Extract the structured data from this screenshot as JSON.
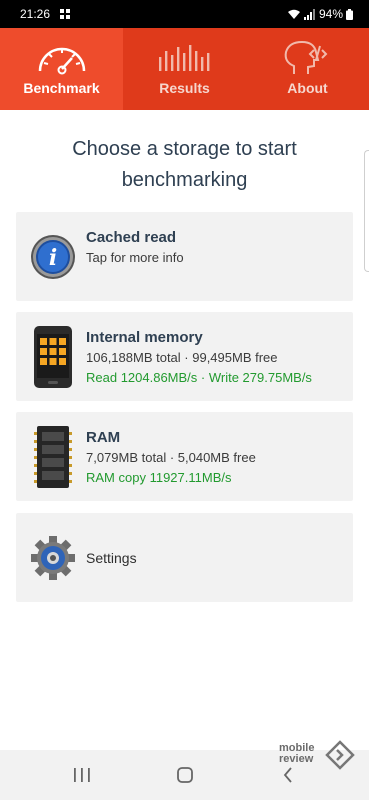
{
  "status_bar": {
    "time": "21:26",
    "battery": "94%"
  },
  "tabs": [
    {
      "label": "Benchmark",
      "icon": "speedometer-icon",
      "active": true
    },
    {
      "label": "Results",
      "icon": "bars-icon",
      "active": false
    },
    {
      "label": "About",
      "icon": "head-code-icon",
      "active": false
    }
  ],
  "heading": {
    "line1": "Choose a storage to start",
    "line2": "benchmarking"
  },
  "cards": {
    "cached": {
      "title": "Cached read",
      "subtitle": "Tap for more info",
      "icon": "info-icon"
    },
    "internal": {
      "title": "Internal memory",
      "details": "106,188MB total · 99,495MB free",
      "speeds": "Read 1204.86MB/s · Write 279.75MB/s",
      "icon": "phone-icon"
    },
    "ram": {
      "title": "RAM",
      "details": "7,079MB total · 5,040MB free",
      "speeds": "RAM copy 11927.11MB/s",
      "icon": "ram-chip-icon"
    },
    "settings": {
      "title": "Settings",
      "icon": "gear-icon"
    }
  },
  "watermark": {
    "line1": "mobile",
    "line2": "review"
  },
  "colors": {
    "tab_bar": "#df3a1b",
    "tab_active": "#ee4c2c",
    "green_text": "#229a2f",
    "heading_text": "#2f4052",
    "card_bg": "#f2f2f2"
  }
}
